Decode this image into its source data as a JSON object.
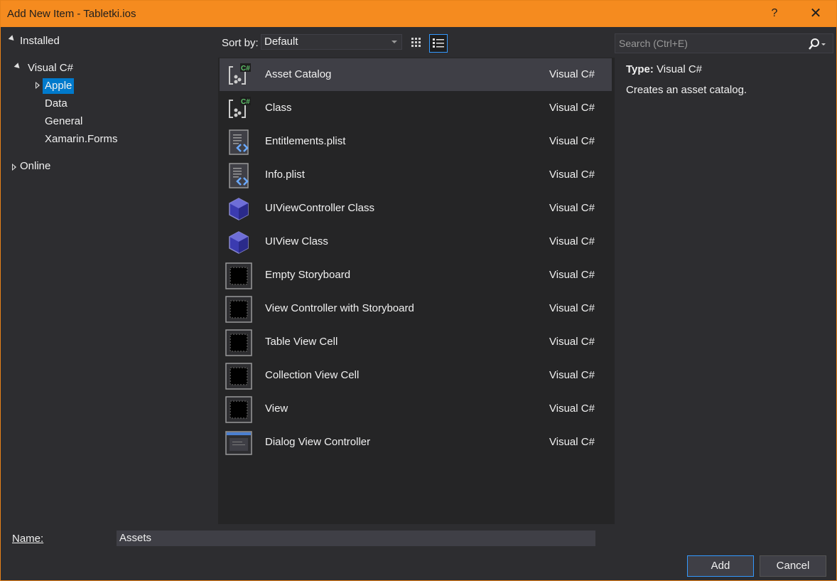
{
  "window": {
    "title": "Add New Item - Tabletki.ios",
    "help_label": "?",
    "close_label": "✕"
  },
  "tree": {
    "installed": "Installed",
    "visual_csharp": "Visual C#",
    "children": [
      "Apple",
      "Data",
      "General",
      "Xamarin.Forms"
    ],
    "online": "Online"
  },
  "toolbar": {
    "sort_label": "Sort by:",
    "sort_value": "Default"
  },
  "search": {
    "placeholder": "Search (Ctrl+E)"
  },
  "templates": [
    {
      "name": "Asset Catalog",
      "type": "Visual C#",
      "icon": "csharp-class-icon"
    },
    {
      "name": "Class",
      "type": "Visual C#",
      "icon": "csharp-class-icon"
    },
    {
      "name": "Entitlements.plist",
      "type": "Visual C#",
      "icon": "plist-icon"
    },
    {
      "name": "Info.plist",
      "type": "Visual C#",
      "icon": "plist-icon"
    },
    {
      "name": "UIViewController Class",
      "type": "Visual C#",
      "icon": "cube-icon"
    },
    {
      "name": "UIView Class",
      "type": "Visual C#",
      "icon": "cube-icon"
    },
    {
      "name": "Empty Storyboard",
      "type": "Visual C#",
      "icon": "storyboard-icon"
    },
    {
      "name": "View Controller with Storyboard",
      "type": "Visual C#",
      "icon": "storyboard-icon"
    },
    {
      "name": "Table View Cell",
      "type": "Visual C#",
      "icon": "storyboard-icon"
    },
    {
      "name": "Collection View Cell",
      "type": "Visual C#",
      "icon": "storyboard-icon"
    },
    {
      "name": "View",
      "type": "Visual C#",
      "icon": "storyboard-icon"
    },
    {
      "name": "Dialog View Controller",
      "type": "Visual C#",
      "icon": "dialog-icon"
    }
  ],
  "details": {
    "type_label": "Type:",
    "type_value": "Visual C#",
    "description": "Creates an asset catalog."
  },
  "footer": {
    "name_label": "Name:",
    "name_value": "Assets",
    "add_label": "Add",
    "cancel_label": "Cancel"
  },
  "colors": {
    "accent": "#f58b1f",
    "selection": "#007acc",
    "background": "#2d2d30"
  }
}
